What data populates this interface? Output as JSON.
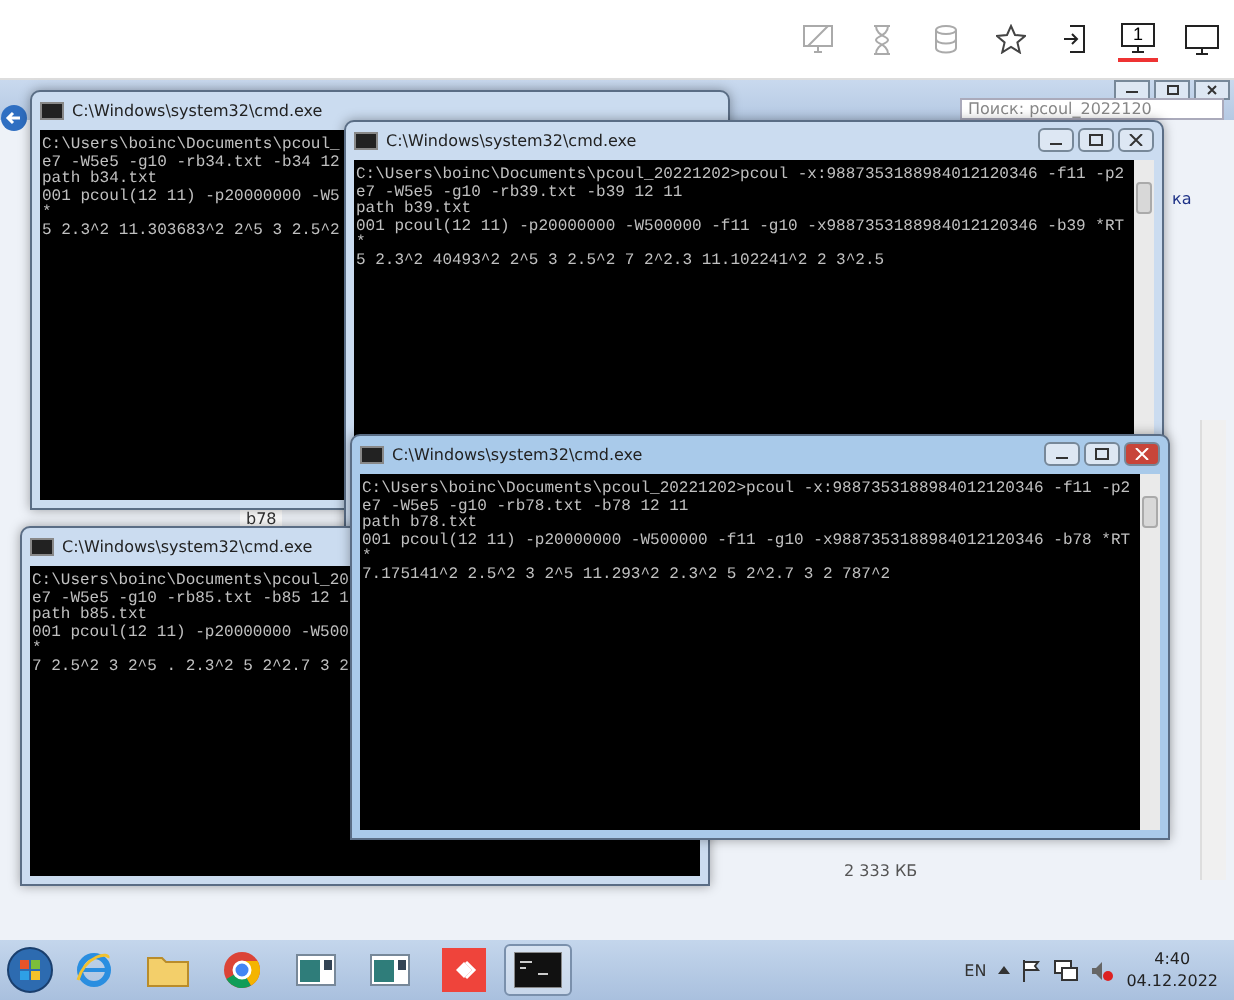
{
  "top_toolbar": {
    "items": [
      {
        "kind": "screen-off",
        "selected": false
      },
      {
        "kind": "hourglass",
        "selected": false
      },
      {
        "kind": "database",
        "selected": false
      },
      {
        "kind": "star",
        "selected": false
      },
      {
        "kind": "login",
        "selected": false
      },
      {
        "kind": "monitor-number",
        "label": "1",
        "selected": true
      },
      {
        "kind": "monitor",
        "selected": false
      }
    ]
  },
  "explorer": {
    "search_placeholder": "Поиск: pcoul_2022120",
    "menu_fragment": "ка",
    "file_name": "b78",
    "file_size": "2 333 КБ"
  },
  "windows": [
    {
      "title": "C:\\Windows\\system32\\cmd.exe",
      "active": false,
      "buttons": false,
      "lines": [
        "C:\\Users\\boinc\\Documents\\pcoul_",
        "e7 -W5e5 -g10 -rb34.txt -b34 12",
        "path b34.txt",
        "001 pcoul(12 11) -p20000000 -W5",
        "*",
        "5 2.3^2 11.303683^2 2^5 3 2.5^2"
      ]
    },
    {
      "title": "C:\\Windows\\system32\\cmd.exe",
      "active": false,
      "buttons": true,
      "lines": [
        "C:\\Users\\boinc\\Documents\\pcoul_20221202>pcoul -x:9887353188984012120346 -f11 -p2",
        "e7 -W5e5 -g10 -rb39.txt -b39 12 11",
        "path b39.txt",
        "001 pcoul(12 11) -p20000000 -W500000 -f11 -g10 -x9887353188984012120346 -b39 *RT",
        "*",
        "5 2.3^2 40493^2 2^5 3 2.5^2 7 2^2.3 11.102241^2 2 3^2.5"
      ]
    },
    {
      "title": "C:\\Windows\\system32\\cmd.exe",
      "active": false,
      "buttons": false,
      "lines": [
        "C:\\Users\\boinc\\Documents\\pcoul_20",
        "e7 -W5e5 -g10 -rb85.txt -b85 12 1",
        "path b85.txt",
        "001 pcoul(12 11) -p20000000 -W500",
        "*",
        "7 2.5^2 3 2^5 . 2.3^2 5 2^2.7 3 2"
      ]
    },
    {
      "title": "C:\\Windows\\system32\\cmd.exe",
      "active": true,
      "buttons": true,
      "lines": [
        "C:\\Users\\boinc\\Documents\\pcoul_20221202>pcoul -x:9887353188984012120346 -f11 -p2",
        "e7 -W5e5 -g10 -rb78.txt -b78 12 11",
        "path b78.txt",
        "001 pcoul(12 11) -p20000000 -W500000 -f11 -g10 -x9887353188984012120346 -b78 *RT",
        "*",
        "7.175141^2 2.5^2 3 2^5 11.293^2 2.3^2 5 2^2.7 3 2 787^2"
      ]
    }
  ],
  "taskbar": {
    "apps": [
      {
        "kind": "ie",
        "selected": false
      },
      {
        "kind": "folder",
        "selected": false
      },
      {
        "kind": "chrome",
        "selected": false
      },
      {
        "kind": "window",
        "selected": false
      },
      {
        "kind": "window",
        "selected": false
      },
      {
        "kind": "remote",
        "selected": false
      },
      {
        "kind": "console",
        "selected": true
      }
    ],
    "language": "EN",
    "time": "4:40",
    "date": "04.12.2022"
  }
}
